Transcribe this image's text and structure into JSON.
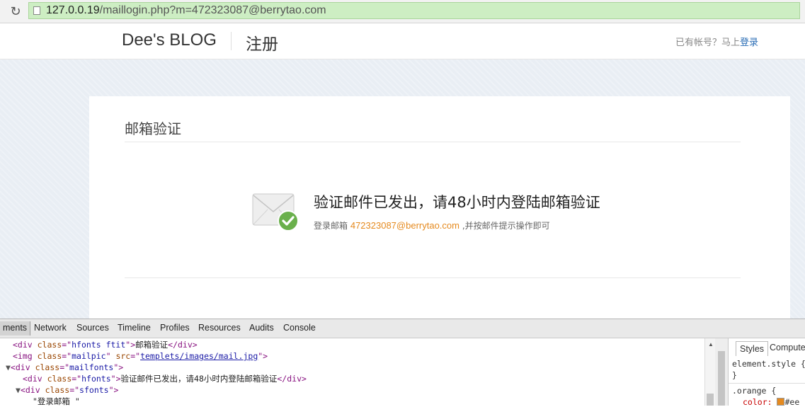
{
  "browser": {
    "url_host": "127.0.0.19",
    "url_path": "/maillogin.php?m=472323087@berrytao.com"
  },
  "header": {
    "brand": "Dee's BLOG",
    "page_title": "注册",
    "have_account_text": "已有帐号？马上",
    "login_link": "登录"
  },
  "card": {
    "title": "邮箱验证",
    "message_main": "验证邮件已发出，请48小时内登陆邮箱验证",
    "message_prefix": "登录邮箱",
    "email": "472323087@berrytao.com",
    "message_suffix": ",并按邮件提示操作即可"
  },
  "devtools": {
    "tabs": [
      "ments",
      "Network",
      "Sources",
      "Timeline",
      "Profiles",
      "Resources",
      "Audits",
      "Console"
    ],
    "lines": {
      "l1_text": "邮箱验证",
      "l2_src": "templets/images/mail.jpg",
      "l4_text": "验证邮件已发出，请48小时内登陆邮箱验证",
      "l6_text": "\"登录邮箱 \""
    },
    "styles_tab": "Styles",
    "computed_tab": "Compute",
    "rule1": "element.style {",
    "rule1_close": "}",
    "rule2": ".orange {",
    "rule2_prop": "color:",
    "rule2_val": "#ee",
    "accent_color": "#e58a1f"
  }
}
